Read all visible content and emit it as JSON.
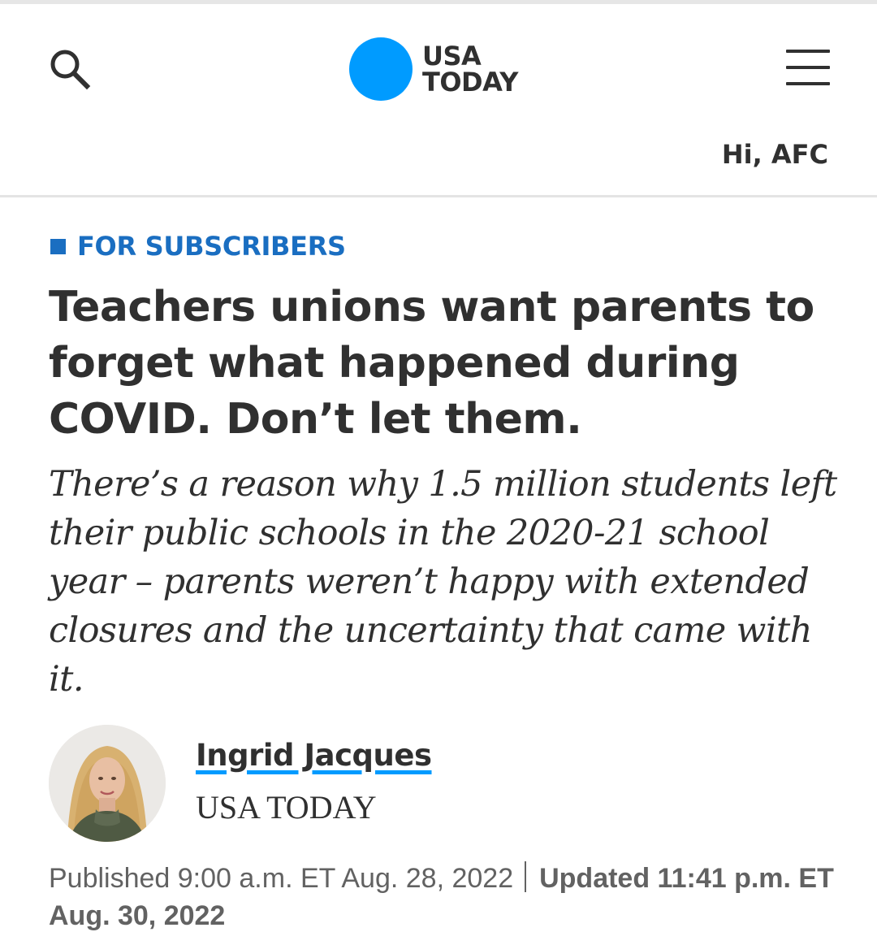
{
  "header": {
    "logo_line1": "USA",
    "logo_line2": "TODAY",
    "greeting": "Hi, AFC",
    "icons": {
      "search": "search-icon",
      "menu": "hamburger-menu-icon"
    },
    "brand_color": "#009bff"
  },
  "article": {
    "label": "FOR SUBSCRIBERS",
    "label_color": "#1a6ec1",
    "headline": "Teachers unions want parents to forget what happened during COVID. Don’t let them.",
    "dek": "There’s a reason why 1.5 million students left their public schools in the 2020-21 school year – parents weren’t happy with extended closures and the uncertainty that came with it.",
    "author": {
      "name": "Ingrid Jacques",
      "org": "USA TODAY"
    },
    "published_label": "Published 9:00 a.m. ET Aug. 28, 2022",
    "updated_label": "Updated 11:41 p.m. ET Aug. 30, 2022"
  }
}
